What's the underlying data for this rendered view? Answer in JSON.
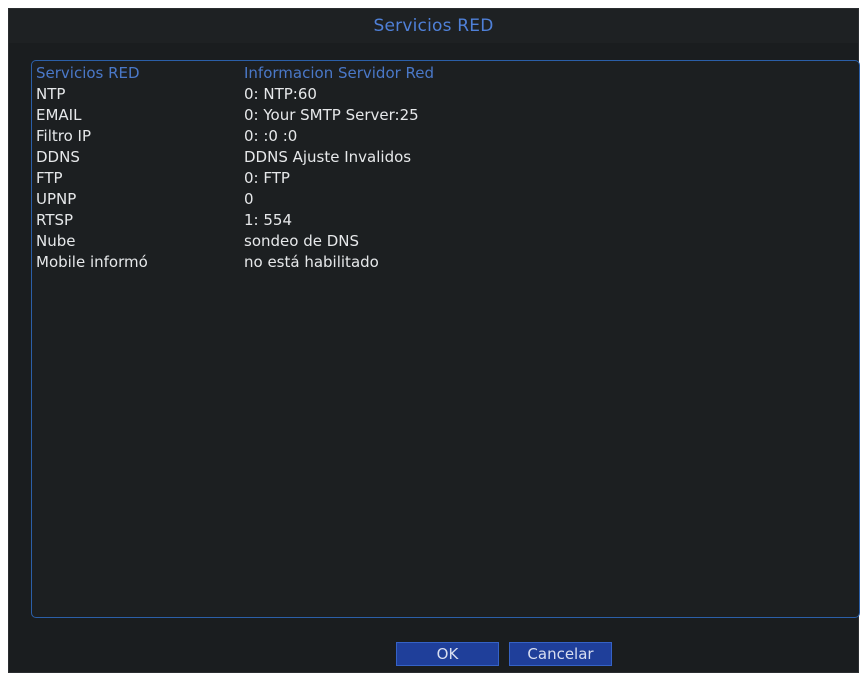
{
  "window": {
    "title": "Servicios RED"
  },
  "table": {
    "headers": {
      "service": "Servicios RED",
      "info": "Informacion Servidor Red"
    },
    "rows": [
      {
        "service": "NTP",
        "info": "0: NTP:60"
      },
      {
        "service": "EMAIL",
        "info": "0: Your SMTP Server:25"
      },
      {
        "service": "Filtro IP",
        "info": "0: :0 :0"
      },
      {
        "service": "DDNS",
        "info": "DDNS Ajuste Invalidos"
      },
      {
        "service": "FTP",
        "info": "0: FTP"
      },
      {
        "service": "UPNP",
        "info": "0"
      },
      {
        "service": "RTSP",
        "info": "1: 554"
      },
      {
        "service": "Nube",
        "info": "sondeo de DNS"
      },
      {
        "service": "Mobile informó",
        "info": "no está habilitado"
      }
    ]
  },
  "buttons": {
    "ok_label": "OK",
    "cancel_label": "Cancelar"
  },
  "colors": {
    "background": "#1a1d1f",
    "accent": "#4f80d8",
    "border": "#2b5fa8",
    "button": "#1f3f9a",
    "text": "#e6e8ea"
  }
}
